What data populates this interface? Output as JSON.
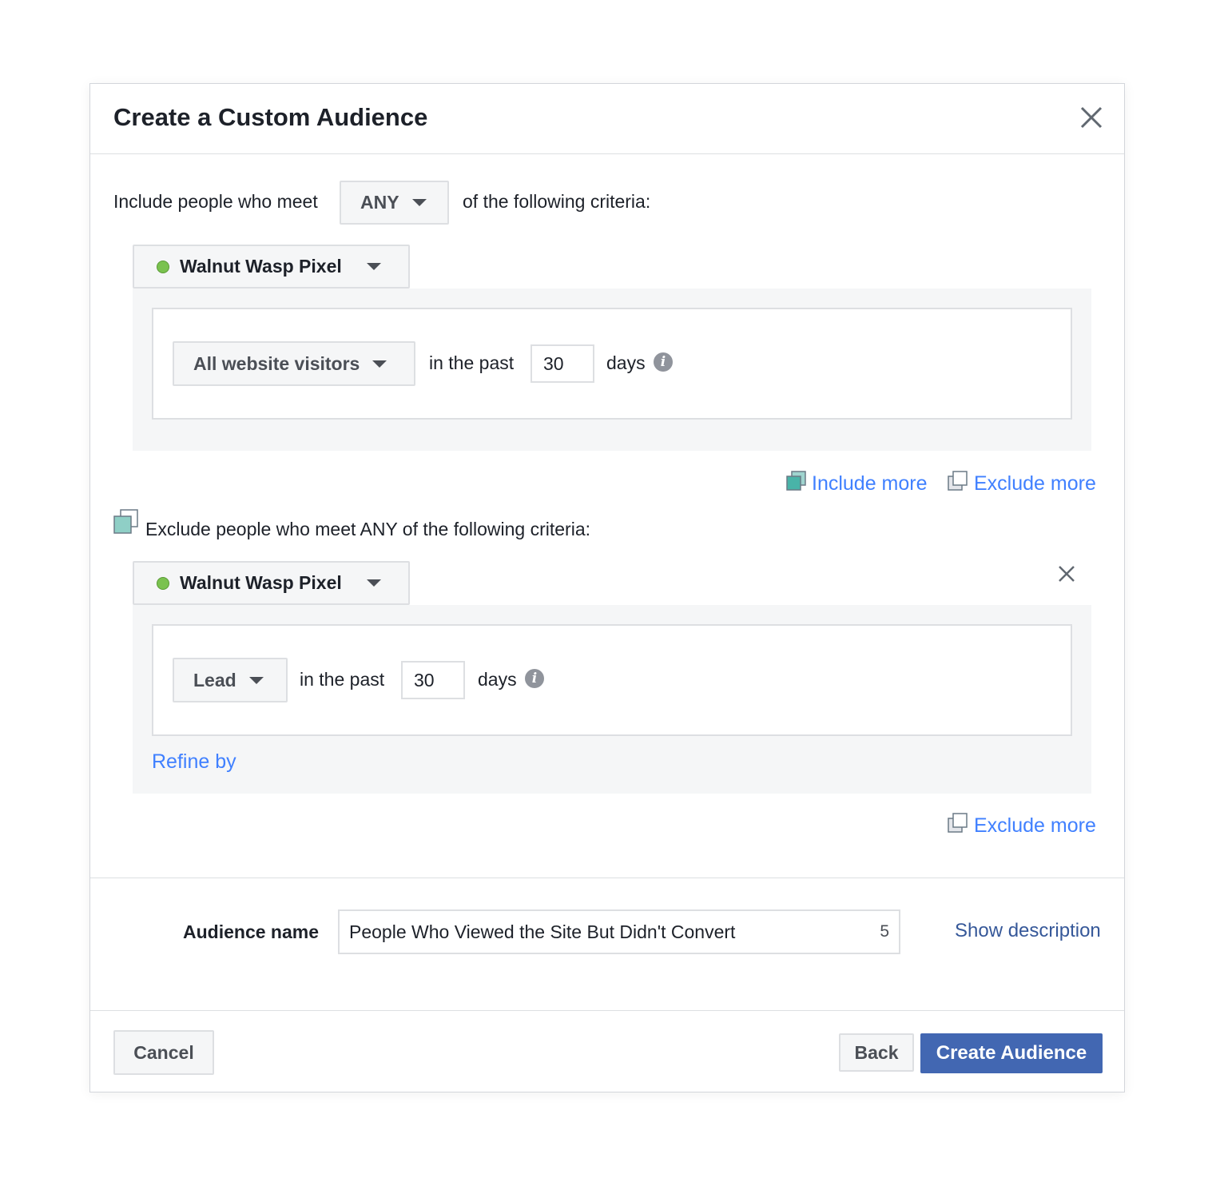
{
  "dialog": {
    "title": "Create a Custom Audience"
  },
  "include": {
    "prefix": "Include people who meet",
    "match_mode": "ANY",
    "suffix": "of the following criteria:",
    "pixel_name": "Walnut Wasp Pixel",
    "event": "All website visitors",
    "in_the_past": "in the past",
    "days_value": "30",
    "days_label": "days"
  },
  "links": {
    "include_more": "Include more",
    "exclude_more": "Exclude more",
    "exclude_more_bottom": "Exclude more",
    "refine_by": "Refine by",
    "show_description": "Show description"
  },
  "exclude": {
    "heading": "Exclude people who meet ANY of the following criteria:",
    "pixel_name": "Walnut Wasp Pixel",
    "event": "Lead",
    "in_the_past": "in the past",
    "days_value": "30",
    "days_label": "days"
  },
  "audience": {
    "label": "Audience name",
    "value": "People Who Viewed the Site But Didn't Convert",
    "char_count": "5"
  },
  "footer": {
    "cancel": "Cancel",
    "back": "Back",
    "create": "Create Audience"
  },
  "colors": {
    "primary": "#4267b2",
    "link": "#4080ff",
    "pixel_status": "#7ac24f",
    "panel_bg": "#f5f6f7"
  }
}
